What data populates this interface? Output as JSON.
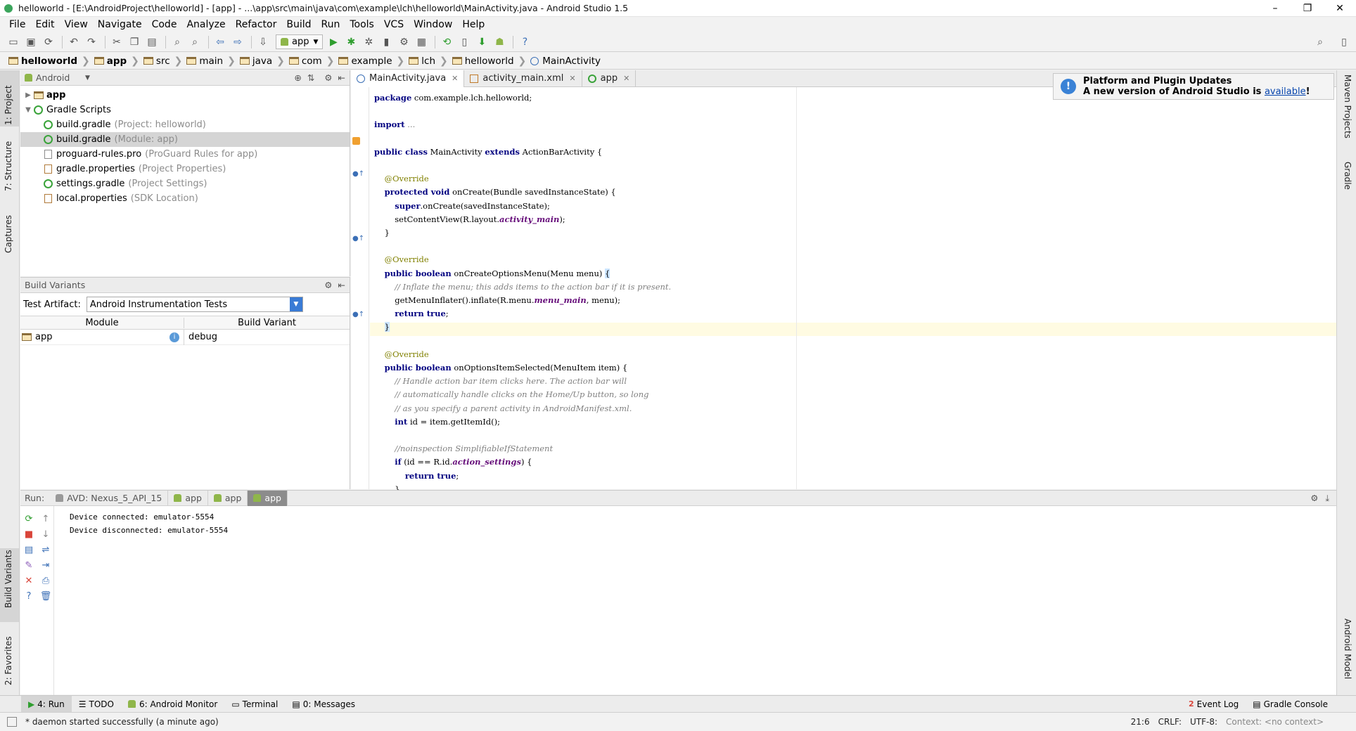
{
  "window": {
    "title": "helloworld - [E:\\AndroidProject\\helloworld] - [app] - ...\\app\\src\\main\\java\\com\\example\\lch\\helloworld\\MainActivity.java - Android Studio 1.5",
    "min": "–",
    "max": "❐",
    "close": "✕"
  },
  "menu": [
    "File",
    "Edit",
    "View",
    "Navigate",
    "Code",
    "Analyze",
    "Refactor",
    "Build",
    "Run",
    "Tools",
    "VCS",
    "Window",
    "Help"
  ],
  "toolbar": {
    "run_config": "app",
    "help": "?"
  },
  "breadcrumb": [
    "helloworld",
    "app",
    "src",
    "main",
    "java",
    "com",
    "example",
    "lch",
    "helloworld",
    "MainActivity"
  ],
  "left_tabs": [
    "1: Project",
    "7: Structure",
    "Captures",
    "Build Variants",
    "2: Favorites"
  ],
  "right_tabs": [
    "Maven Projects",
    "Gradle",
    "Android Model"
  ],
  "project": {
    "view": "Android",
    "tree": [
      {
        "label": "app",
        "hint": "",
        "level": 0,
        "expanded": false,
        "icon": "folder-icon"
      },
      {
        "label": "Gradle Scripts",
        "hint": "",
        "level": 0,
        "expanded": true,
        "icon": "gradle-icon"
      },
      {
        "label": "build.gradle",
        "hint": "(Project: helloworld)",
        "level": 1,
        "icon": "gradle-icon"
      },
      {
        "label": "build.gradle",
        "hint": "(Module: app)",
        "level": 1,
        "icon": "gradle-icon",
        "selected": true
      },
      {
        "label": "proguard-rules.pro",
        "hint": "(ProGuard Rules for app)",
        "level": 1,
        "icon": "file-icon"
      },
      {
        "label": "gradle.properties",
        "hint": "(Project Properties)",
        "level": 1,
        "icon": "properties-icon"
      },
      {
        "label": "settings.gradle",
        "hint": "(Project Settings)",
        "level": 1,
        "icon": "gradle-icon"
      },
      {
        "label": "local.properties",
        "hint": "(SDK Location)",
        "level": 1,
        "icon": "properties-icon"
      }
    ]
  },
  "build_variants": {
    "title": "Build Variants",
    "test_artifact_label": "Test Artifact:",
    "test_artifact_value": "Android Instrumentation Tests",
    "col_module": "Module",
    "col_variant": "Build Variant",
    "rows": [
      {
        "module": "app",
        "variant": "debug"
      }
    ]
  },
  "editor": {
    "tabs": [
      {
        "label": "MainActivity.java",
        "active": true
      },
      {
        "label": "activity_main.xml",
        "active": false
      },
      {
        "label": "app",
        "active": false
      }
    ]
  },
  "notification": {
    "title": "Platform and Plugin Updates",
    "text": "A new version of Android Studio is ",
    "link": "available",
    "tail": "!"
  },
  "run": {
    "label": "Run:",
    "tabs": [
      "AVD: Nexus_5_API_15",
      "app",
      "app",
      "app"
    ],
    "console": [
      "Device connected: emulator-5554",
      "Device disconnected: emulator-5554"
    ]
  },
  "bottom_tabs": {
    "left": [
      "4: Run",
      "TODO",
      "6: Android Monitor",
      "Terminal",
      "0: Messages"
    ],
    "right": [
      "Event Log",
      "Gradle Console"
    ],
    "event_count": "2"
  },
  "status": {
    "message": "* daemon started successfully (a minute ago)",
    "position": "21:6",
    "line_sep": "CRLF:",
    "encoding": "UTF-8:",
    "context": "Context: <no context>"
  }
}
